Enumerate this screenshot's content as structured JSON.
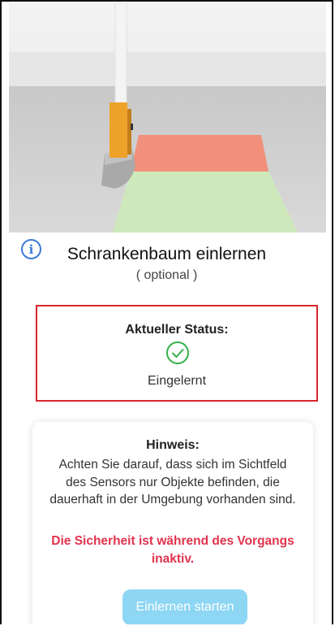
{
  "header": {
    "title": "Schrankenbaum einlernen",
    "subtitle": "( optional )"
  },
  "status": {
    "label": "Aktueller Status:",
    "value": "Eingelernt",
    "icon": "check-circle-icon",
    "icon_color": "#35b04a",
    "border_color": "#d7262b"
  },
  "note": {
    "title": "Hinweis:",
    "text": "Achten Sie darauf, dass sich im Sichtfeld des Sensors nur Objekte befinden, die dauerhaft in der Umgebung vorhanden sind.",
    "warning": "Die Sicherheit ist während des Vorgangs inaktiv.",
    "warning_color": "#e0334d"
  },
  "actions": {
    "start_label": "Einlernen starten",
    "start_color": "#8dd6f4"
  },
  "info": {
    "icon": "info-icon",
    "glyph": "i",
    "color": "#3d7bd6"
  }
}
